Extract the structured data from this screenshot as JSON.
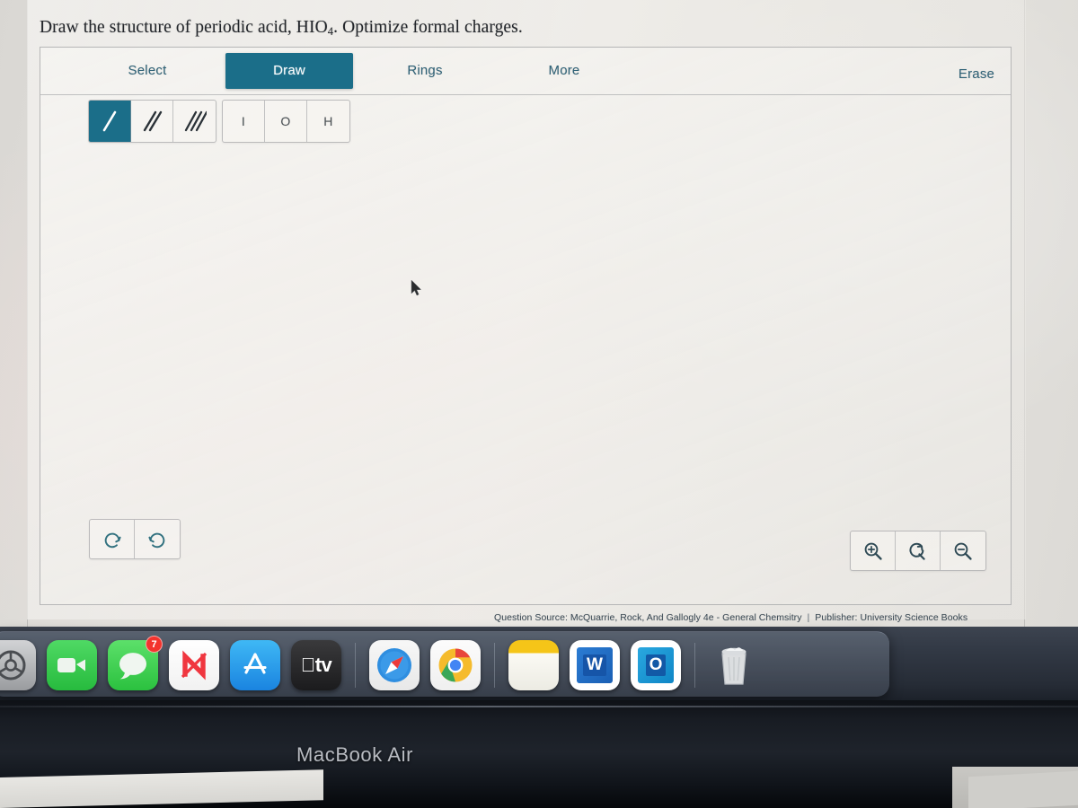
{
  "question": {
    "prefix": "Draw the structure of periodic acid, HIO",
    "subscript": "4",
    "suffix": ". Optimize formal charges."
  },
  "editor": {
    "tabs": [
      {
        "label": "Select",
        "active": false
      },
      {
        "label": "Draw",
        "active": true
      },
      {
        "label": "Rings",
        "active": false
      },
      {
        "label": "More",
        "active": false
      }
    ],
    "erase_label": "Erase",
    "bond_tools": [
      {
        "name": "single-bond",
        "active": true
      },
      {
        "name": "double-bond",
        "active": false
      },
      {
        "name": "triple-bond",
        "active": false
      }
    ],
    "element_tools": [
      {
        "label": "I",
        "name": "iodine"
      },
      {
        "label": "O",
        "name": "oxygen"
      },
      {
        "label": "H",
        "name": "hydrogen"
      }
    ],
    "history_tools": [
      {
        "name": "undo-icon"
      },
      {
        "name": "redo-icon"
      }
    ],
    "zoom_tools": [
      {
        "name": "zoom-in-icon"
      },
      {
        "name": "zoom-reset-icon"
      },
      {
        "name": "zoom-out-icon"
      }
    ],
    "accent_color": "#1b6e89",
    "tab_text_color": "#2f6277"
  },
  "credit": {
    "source": "Question Source: McQuarrie, Rock, And Gallogly 4e - General Chemsitry",
    "separator": "|",
    "publisher": "Publisher: University Science Books"
  },
  "dock": {
    "items": [
      {
        "name": "system-preferences-icon",
        "label": ""
      },
      {
        "name": "facetime-icon",
        "label": ""
      },
      {
        "name": "messages-icon",
        "label": "",
        "badge": "7"
      },
      {
        "name": "news-icon",
        "label": ""
      },
      {
        "name": "app-store-icon",
        "label": ""
      },
      {
        "name": "apple-tv-icon",
        "label": "tv"
      },
      {
        "name": "safari-icon",
        "label": ""
      },
      {
        "name": "chrome-icon",
        "label": ""
      },
      {
        "name": "notes-icon",
        "label": ""
      },
      {
        "name": "microsoft-word-icon",
        "label": "W"
      },
      {
        "name": "microsoft-outlook-icon",
        "label": "O"
      },
      {
        "name": "trash-icon",
        "label": ""
      }
    ]
  },
  "laptop": {
    "brand": "MacBook Air"
  }
}
